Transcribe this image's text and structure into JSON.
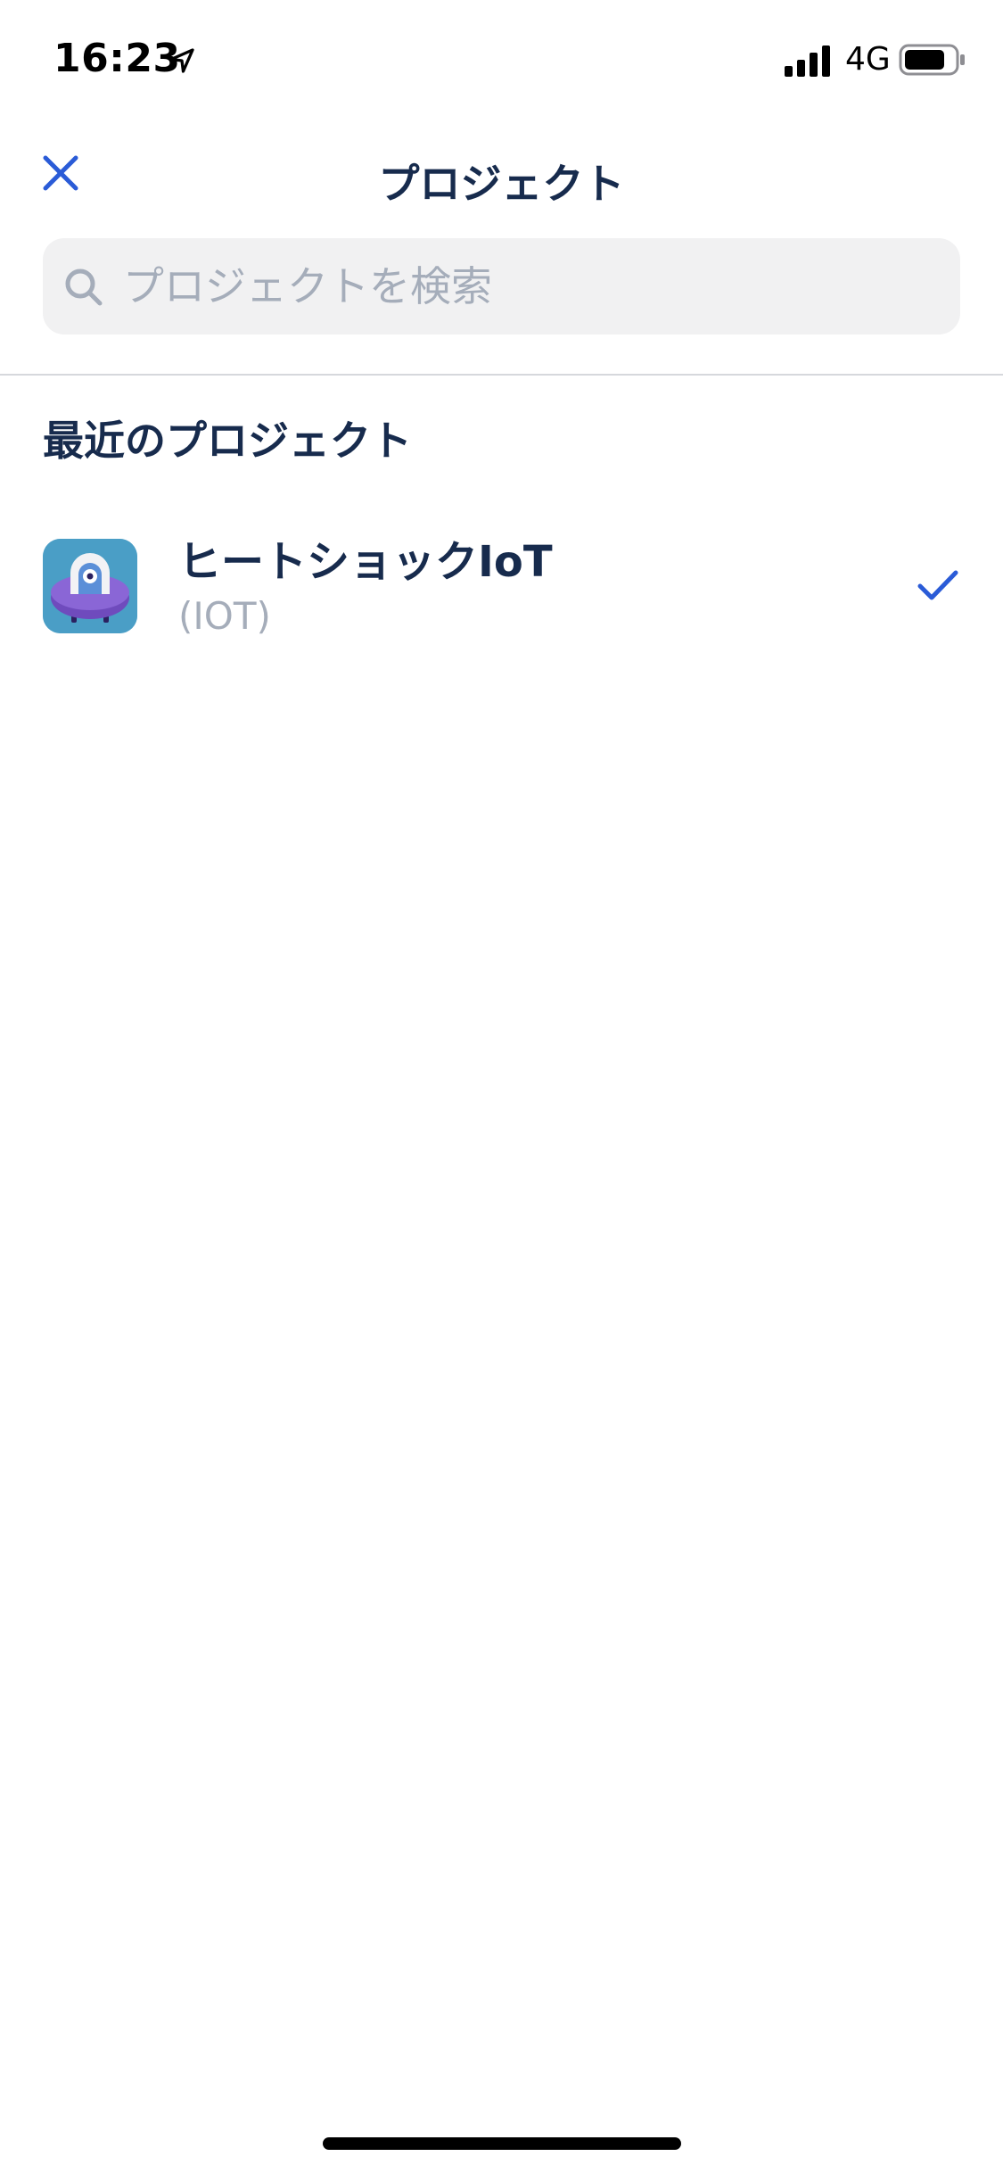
{
  "status_bar": {
    "time": "16:23",
    "network": "4G"
  },
  "header": {
    "title": "プロジェクト"
  },
  "search": {
    "placeholder": "プロジェクトを検索"
  },
  "recent": {
    "section_title": "最近のプロジェクト",
    "items": [
      {
        "name": "ヒートショックIoT",
        "key": "(IOT)",
        "selected": true
      }
    ]
  },
  "colors": {
    "accent": "#2a5bd7",
    "text_primary": "#172b4d",
    "text_secondary": "#a5adba",
    "search_bg": "#f1f1f2"
  },
  "icons": {
    "close": "close-icon",
    "search": "search-icon",
    "check": "checkmark-icon",
    "location": "location-arrow-icon",
    "signal": "cellular-signal-icon",
    "battery": "battery-icon"
  }
}
